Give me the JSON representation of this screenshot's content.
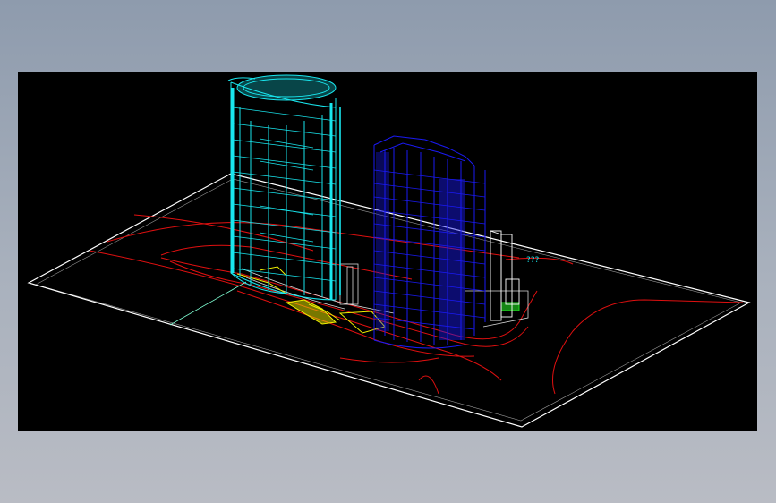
{
  "viewport": {
    "background": "#000000"
  },
  "model": {
    "site_outline_color": "#ffffff",
    "road_line_color": "#e01010",
    "tower_a_color": "#19e6ee",
    "tower_b_color": "#1a1af5",
    "podium_accent_color": "#f0f000",
    "plaza_accent_color": "#20e020",
    "axis_line_color": "#7fffd4"
  },
  "annotation_text": "???"
}
